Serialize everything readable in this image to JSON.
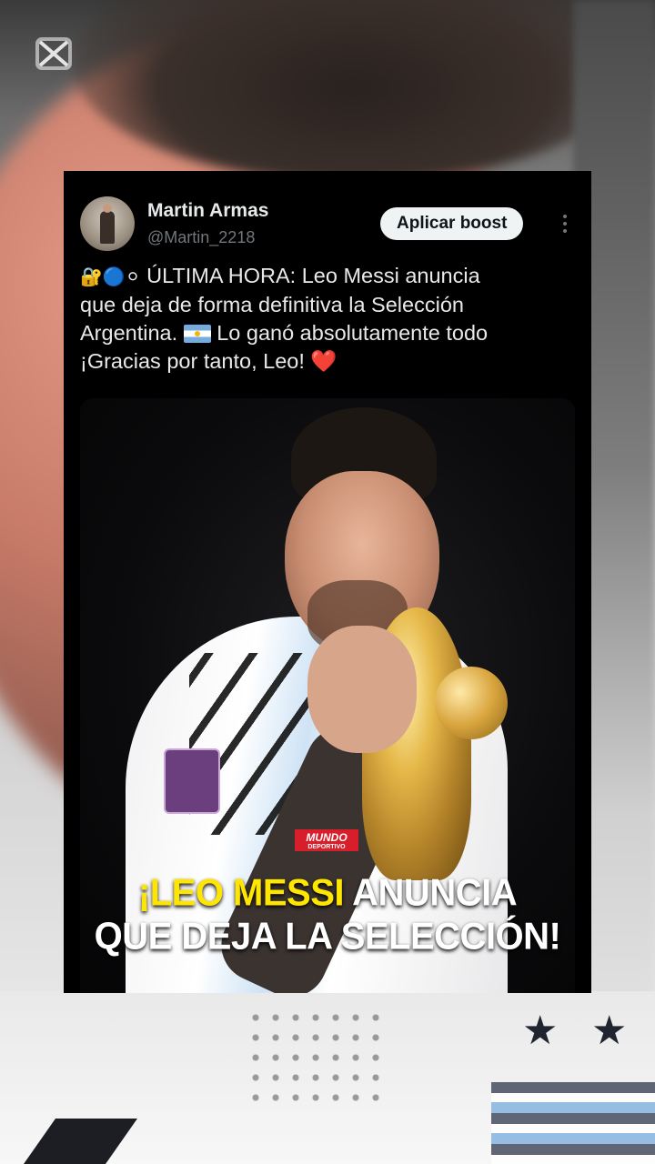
{
  "tweet": {
    "author_name": "Martin Armas",
    "author_handle": "@Martin_2218",
    "boost_label": "Aplicar boost",
    "text_emoji_prefix": "🔐🔵⚪",
    "text_line_1": " ÚLTIMA HORA: Leo Messi anuncia",
    "text_line_2": "que deja de forma definitiva la Selección",
    "text_line_3": "Argentina.",
    "text_line_4": " Lo ganó absolutamente todo",
    "text_line_5": "¡Gracias por tanto, Leo! ",
    "heart": "❤️"
  },
  "media": {
    "logo_top": "MUNDO",
    "logo_bottom": "DEPORTIVO",
    "headline_highlight": "¡LEO MESSI",
    "headline_rest_1": " ANUNCIA",
    "headline_line_2": "QUE DEJA LA SELECCIÓN!",
    "highlight_color": "#ffe600"
  },
  "icons": {
    "capcut": "capcut-logo-icon",
    "more": "more-vertical-icon"
  }
}
